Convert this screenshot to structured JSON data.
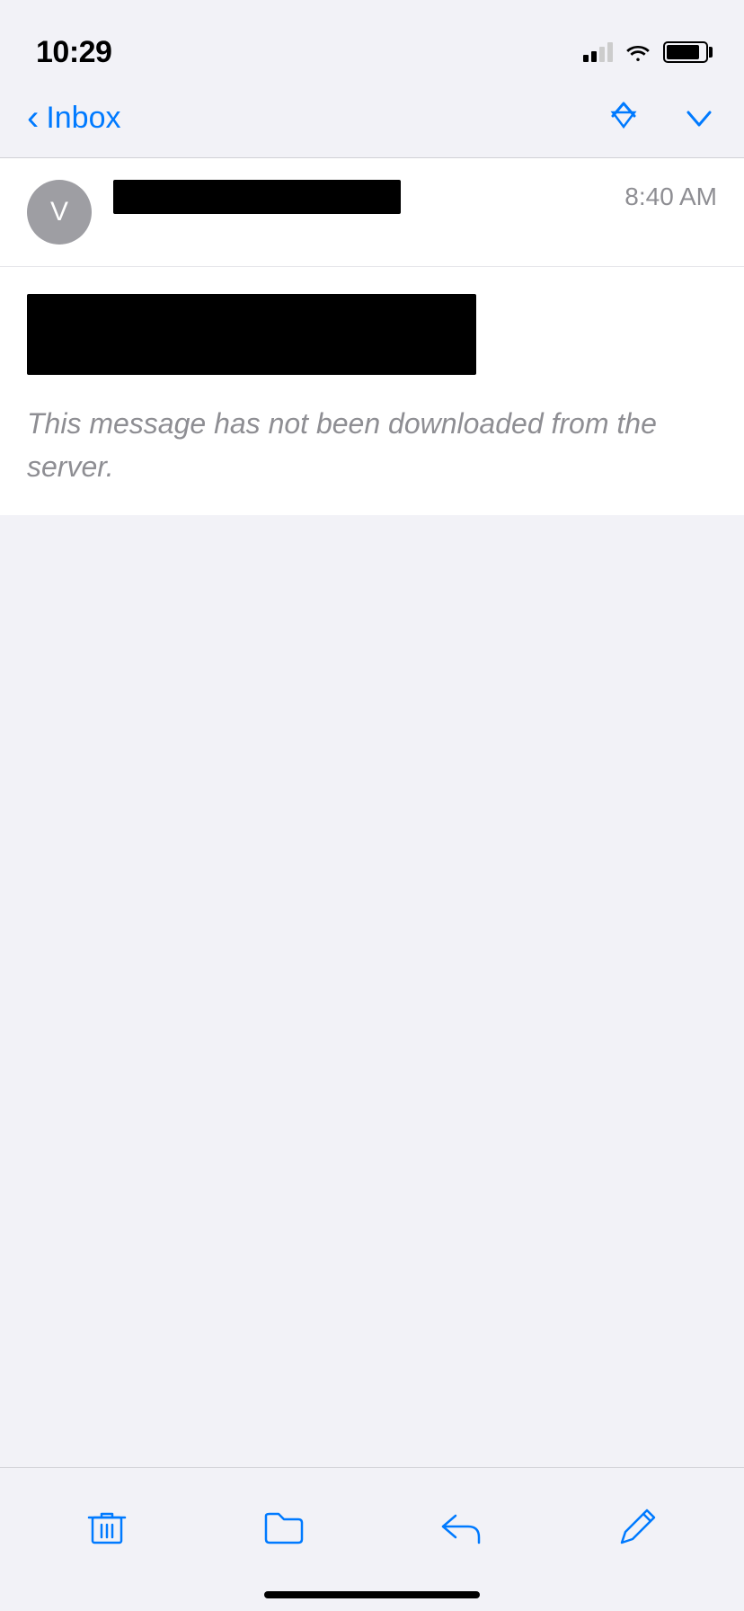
{
  "statusBar": {
    "time": "10:29",
    "battery": 85
  },
  "navBar": {
    "backLabel": "Inbox",
    "upArrow": "▲",
    "downArrow": "▼"
  },
  "email": {
    "senderInitial": "V",
    "time": "8:40 AM",
    "notDownloadedText": "This message has not been downloaded from the server."
  },
  "toolbar": {
    "deleteLabel": "Delete",
    "moveLabel": "Move",
    "replyLabel": "Reply",
    "composeLabel": "Compose"
  }
}
